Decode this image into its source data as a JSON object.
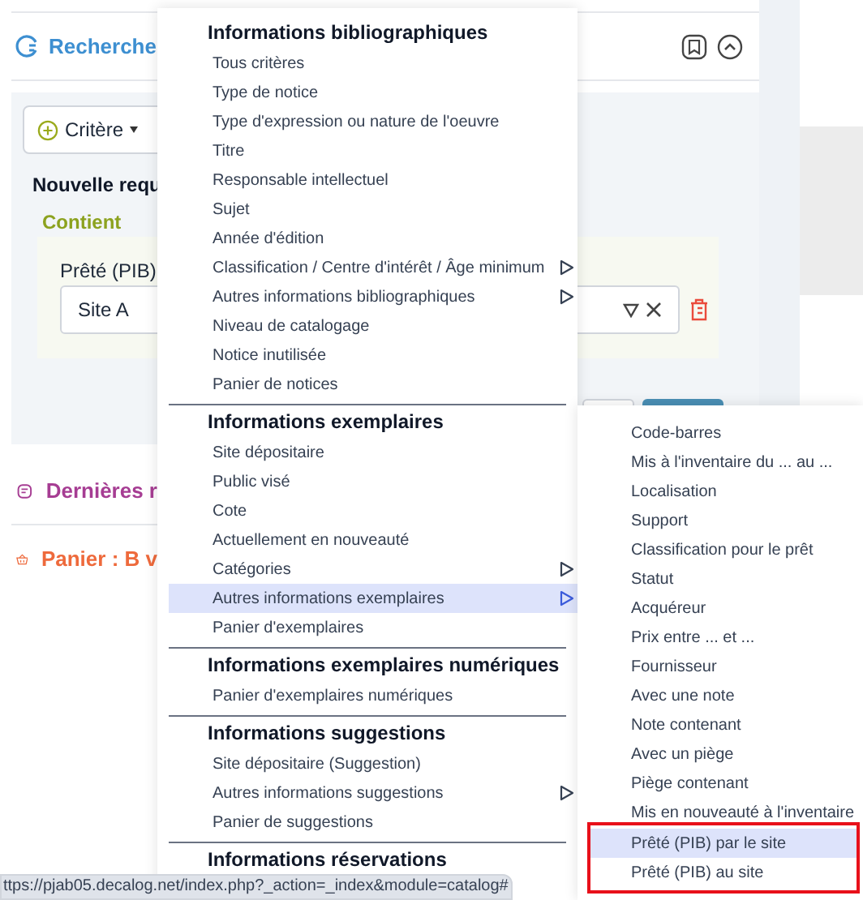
{
  "search_panel": {
    "title": "Recherche",
    "criteria_button": {
      "label": "Critère"
    },
    "query_title": "Nouvelle requ",
    "operator": "Contient",
    "criterion": {
      "label": "Prêté (PIB)",
      "value": "Site A"
    }
  },
  "sections": [
    {
      "title": "Dernières r",
      "color": "#a63d93"
    },
    {
      "title": "Panier : B v",
      "color": "#ee6a3c"
    }
  ],
  "menu": {
    "groups": [
      {
        "heading": "Informations bibliographiques",
        "items": [
          {
            "label": "Tous critères",
            "selected": false,
            "has_submenu": false
          },
          {
            "label": "Type de notice",
            "selected": false,
            "has_submenu": false
          },
          {
            "label": "Type d'expression ou nature de l'oeuvre",
            "selected": false,
            "has_submenu": false
          },
          {
            "label": "Titre",
            "selected": false,
            "has_submenu": false
          },
          {
            "label": "Responsable intellectuel",
            "selected": false,
            "has_submenu": false
          },
          {
            "label": "Sujet",
            "selected": false,
            "has_submenu": false
          },
          {
            "label": "Année d'édition",
            "selected": false,
            "has_submenu": false
          },
          {
            "label": "Classification / Centre d'intérêt / Âge minimum",
            "selected": false,
            "has_submenu": true
          },
          {
            "label": "Autres informations bibliographiques",
            "selected": false,
            "has_submenu": true
          },
          {
            "label": "Niveau de catalogage",
            "selected": false,
            "has_submenu": false
          },
          {
            "label": "Notice inutilisée",
            "selected": false,
            "has_submenu": false
          },
          {
            "label": "Panier de notices",
            "selected": false,
            "has_submenu": false
          }
        ]
      },
      {
        "heading": "Informations exemplaires",
        "items": [
          {
            "label": "Site dépositaire",
            "selected": false,
            "has_submenu": false
          },
          {
            "label": "Public visé",
            "selected": false,
            "has_submenu": false
          },
          {
            "label": "Cote",
            "selected": false,
            "has_submenu": false
          },
          {
            "label": "Actuellement en nouveauté",
            "selected": false,
            "has_submenu": false
          },
          {
            "label": "Catégories",
            "selected": false,
            "has_submenu": true
          },
          {
            "label": "Autres informations exemplaires",
            "selected": true,
            "has_submenu": true
          },
          {
            "label": "Panier d'exemplaires",
            "selected": false,
            "has_submenu": false
          }
        ]
      },
      {
        "heading": "Informations exemplaires numériques",
        "items": [
          {
            "label": "Panier d'exemplaires numériques",
            "selected": false,
            "has_submenu": false
          }
        ]
      },
      {
        "heading": "Informations suggestions",
        "items": [
          {
            "label": "Site dépositaire (Suggestion)",
            "selected": false,
            "has_submenu": false
          },
          {
            "label": "Autres informations suggestions",
            "selected": false,
            "has_submenu": true
          },
          {
            "label": "Panier de suggestions",
            "selected": false,
            "has_submenu": false
          }
        ]
      },
      {
        "heading": "Informations réservations"
      }
    ]
  },
  "submenu": {
    "items": [
      {
        "label": "Code-barres",
        "selected": false,
        "highlighted": false
      },
      {
        "label": "Mis à l'inventaire du ... au ...",
        "selected": false,
        "highlighted": false
      },
      {
        "label": "Localisation",
        "selected": false,
        "highlighted": false
      },
      {
        "label": "Support",
        "selected": false,
        "highlighted": false
      },
      {
        "label": "Classification pour le prêt",
        "selected": false,
        "highlighted": false
      },
      {
        "label": "Statut",
        "selected": false,
        "highlighted": false
      },
      {
        "label": "Acquéreur",
        "selected": false,
        "highlighted": false
      },
      {
        "label": "Prix entre ... et ...",
        "selected": false,
        "highlighted": false
      },
      {
        "label": "Fournisseur",
        "selected": false,
        "highlighted": false
      },
      {
        "label": "Avec une note",
        "selected": false,
        "highlighted": false
      },
      {
        "label": "Note contenant",
        "selected": false,
        "highlighted": false
      },
      {
        "label": "Avec un piège",
        "selected": false,
        "highlighted": false
      },
      {
        "label": "Piège contenant",
        "selected": false,
        "highlighted": false
      },
      {
        "label": "Mis en nouveauté à l'inventaire",
        "selected": false,
        "highlighted": false
      },
      {
        "label": "Prêté (PIB) par le site",
        "selected": true,
        "highlighted": true
      },
      {
        "label": "Prêté (PIB) au site",
        "selected": false,
        "highlighted": true
      }
    ]
  },
  "status_bar": {
    "url": "ttps://pjab05.decalog.net/index.php?_action=_index&module=catalog#"
  }
}
